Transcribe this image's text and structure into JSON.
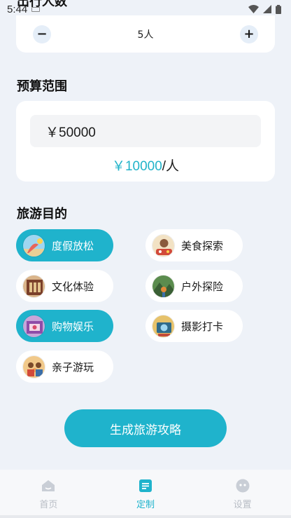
{
  "status_bar": {
    "time": "5:44"
  },
  "top_section": {
    "title": "出行人数"
  },
  "people": {
    "minus": "−",
    "value": "5人",
    "plus": "+"
  },
  "budget": {
    "title": "预算范围",
    "input_value": "￥50000",
    "per_person_amount": "￥10000",
    "per_person_unit": "/人"
  },
  "purpose": {
    "title": "旅游目的",
    "options": [
      {
        "label": "度假放松",
        "selected": true,
        "icon": "beach-icon"
      },
      {
        "label": "美食探索",
        "selected": false,
        "icon": "food-icon"
      },
      {
        "label": "文化体验",
        "selected": false,
        "icon": "culture-icon"
      },
      {
        "label": "户外探险",
        "selected": false,
        "icon": "outdoor-icon"
      },
      {
        "label": "购物娱乐",
        "selected": true,
        "icon": "shopping-icon"
      },
      {
        "label": "摄影打卡",
        "selected": false,
        "icon": "camera-icon"
      },
      {
        "label": "亲子游玩",
        "selected": false,
        "icon": "family-icon"
      }
    ]
  },
  "generate_button": "生成旅游攻略",
  "tabbar": {
    "items": [
      {
        "label": "首页",
        "active": false,
        "icon": "home-icon"
      },
      {
        "label": "定制",
        "active": true,
        "icon": "custom-icon"
      },
      {
        "label": "设置",
        "active": false,
        "icon": "settings-icon"
      }
    ]
  },
  "colors": {
    "accent": "#1fb3cc",
    "background": "#eef2f8",
    "inactive": "#b9bec6"
  }
}
